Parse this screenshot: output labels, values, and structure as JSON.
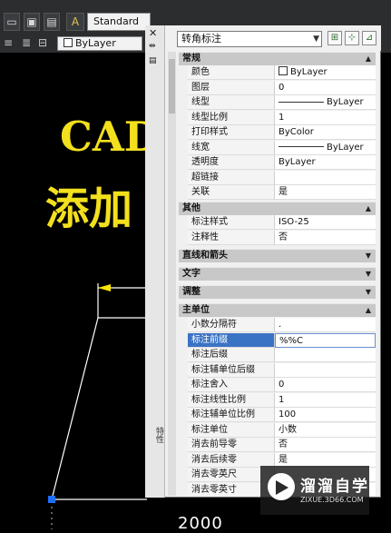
{
  "toolbar": {
    "text_style_button": "A",
    "text_style_value": "Standard",
    "layer_value": "ByLayer",
    "close_glyph": "✕"
  },
  "canvas": {
    "title_line1": "CAD",
    "title_line2": "添加",
    "dimension_text": "2000"
  },
  "palette": {
    "object_type": "转角标注",
    "side_label": "特性",
    "sections": {
      "general": "常规",
      "misc": "其他",
      "lines_arrows": "直线和箭头",
      "text": "文字",
      "fit": "调整",
      "primary_units": "主单位"
    },
    "general_rows": [
      {
        "name": "颜色",
        "value": "ByLayer"
      },
      {
        "name": "图层",
        "value": "0"
      },
      {
        "name": "线型",
        "value": "ByLayer"
      },
      {
        "name": "线型比例",
        "value": "1"
      },
      {
        "name": "打印样式",
        "value": "ByColor"
      },
      {
        "name": "线宽",
        "value": "ByLayer"
      },
      {
        "name": "透明度",
        "value": "ByLayer"
      },
      {
        "name": "超链接",
        "value": ""
      },
      {
        "name": "关联",
        "value": "是"
      }
    ],
    "misc_rows": [
      {
        "name": "标注样式",
        "value": "ISO-25"
      },
      {
        "name": "注释性",
        "value": "否"
      }
    ],
    "units_rows": [
      {
        "name": "小数分隔符",
        "value": "."
      },
      {
        "name": "标注前缀",
        "value": "%%C"
      },
      {
        "name": "标注后缀",
        "value": ""
      },
      {
        "name": "标注辅单位后缀",
        "value": ""
      },
      {
        "name": "标注舍入",
        "value": "0"
      },
      {
        "name": "标注线性比例",
        "value": "1"
      },
      {
        "name": "标注辅单位比例",
        "value": "100"
      },
      {
        "name": "标注单位",
        "value": "小数"
      },
      {
        "name": "消去前导零",
        "value": "否"
      },
      {
        "name": "消去后续零",
        "value": "是"
      },
      {
        "name": "消去零英尺",
        "value": ""
      },
      {
        "name": "消去零英寸",
        "value": ""
      }
    ]
  },
  "watermark": {
    "brand": "溜溜自学",
    "site": "ZIXUE.3D66.COM"
  },
  "colors": {
    "canvas": "#000000",
    "cad_text": "#f3e01d",
    "dim_line": "#ffffff",
    "selection": "#3b73c4"
  }
}
